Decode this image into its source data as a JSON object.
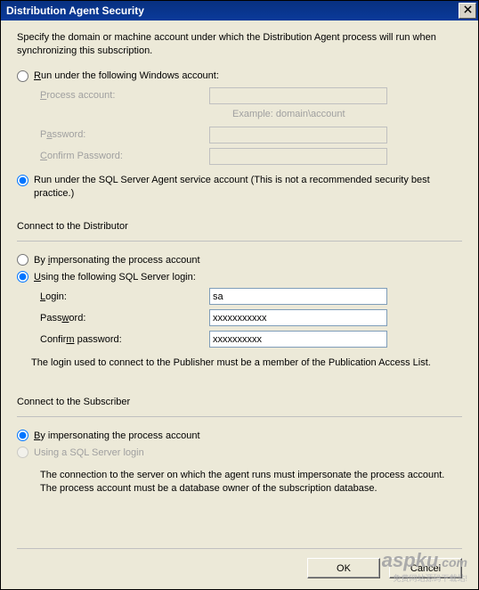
{
  "titlebar": {
    "title": "Distribution Agent Security"
  },
  "intro": "Specify the domain or machine account under which the Distribution Agent process will run when synchronizing this subscription.",
  "runAs": {
    "opt_windows": "Run under the following Windows account:",
    "process_account_lbl": "Process account:",
    "process_account_val": "",
    "example": "Example: domain\\account",
    "password_lbl": "Password:",
    "password_val": "",
    "confirm_lbl": "Confirm Password:",
    "confirm_val": "",
    "opt_sqlagent": "Run under the SQL Server Agent service account (This is not a recommended security best practice.)"
  },
  "distributor": {
    "heading": "Connect to the Distributor",
    "opt_impersonate": "By impersonating the process account",
    "opt_sqllogin": "Using the following SQL Server login:",
    "login_lbl": "Login:",
    "login_val": "sa",
    "password_lbl": "Password:",
    "password_val": "xxxxxxxxxxx",
    "confirm_lbl": "Confirm password:",
    "confirm_val": "xxxxxxxxxx",
    "note": "The login used to connect to the Publisher must be a member of the Publication Access List."
  },
  "subscriber": {
    "heading": "Connect to the Subscriber",
    "opt_impersonate": "By impersonating the process account",
    "opt_sqllogin": "Using a SQL Server login",
    "note": "The connection to the server on which the agent runs must impersonate the process account. The process account must be a database owner of the subscription database."
  },
  "buttons": {
    "ok": "OK",
    "cancel": "Cancel"
  },
  "watermark": {
    "text": "aspku",
    "suffix": ".com",
    "sub": "免费网站源码下载站!"
  }
}
